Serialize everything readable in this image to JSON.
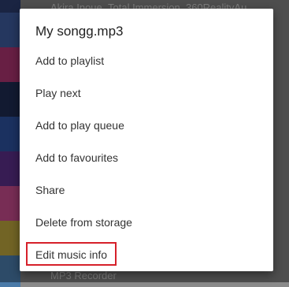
{
  "background_list": {
    "top_item": "Akira Inoue_Total Immersion_360RealityAu...",
    "bottom_item": "MP3 Recorder"
  },
  "context_menu": {
    "title": "My songg.mp3",
    "items": [
      {
        "label": "Add to playlist"
      },
      {
        "label": "Play next"
      },
      {
        "label": "Add to play queue"
      },
      {
        "label": "Add to favourites"
      },
      {
        "label": "Share"
      },
      {
        "label": "Delete from storage"
      },
      {
        "label": "Edit music info"
      }
    ],
    "highlight_color": "#d6202a"
  }
}
